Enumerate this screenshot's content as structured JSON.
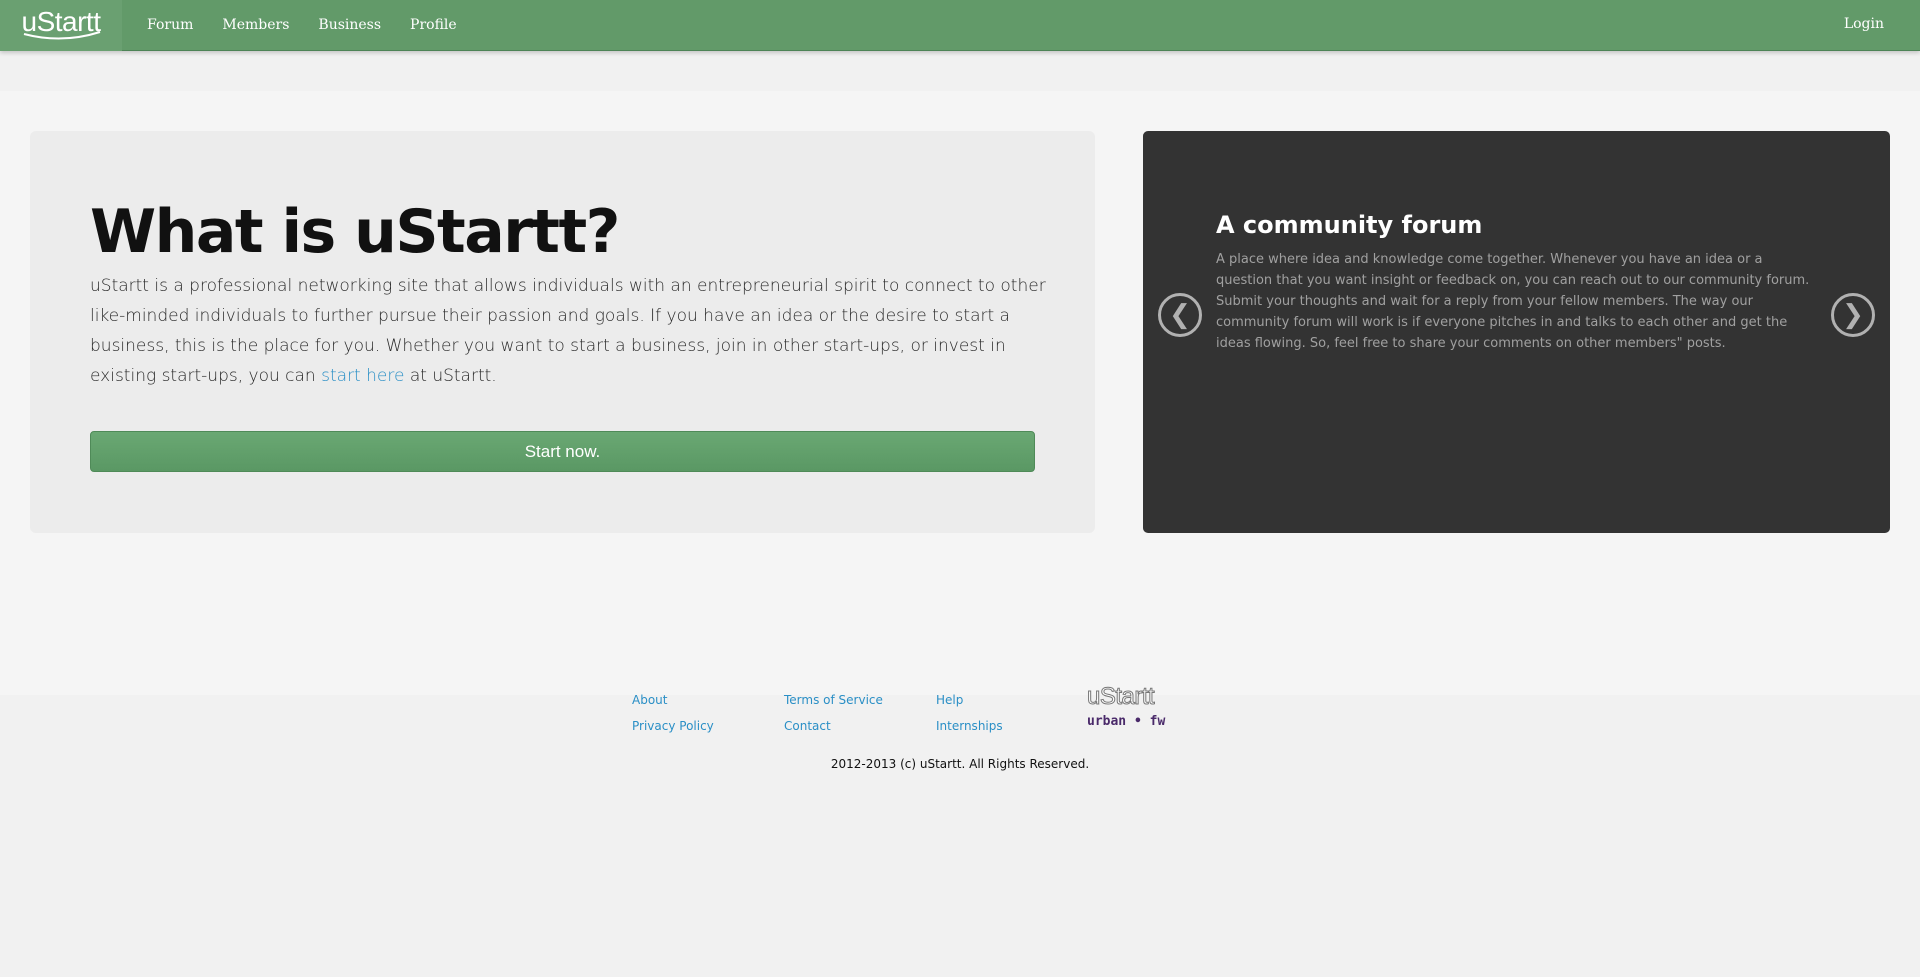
{
  "navbar": {
    "brand": "uStartt",
    "links": [
      {
        "label": "Forum"
      },
      {
        "label": "Members"
      },
      {
        "label": "Business"
      },
      {
        "label": "Profile"
      }
    ],
    "login": "Login",
    "colors": {
      "bar": "#629a69",
      "brand_bg": "#6aa071"
    }
  },
  "hero": {
    "title": "What is uStartt?",
    "body_before_link": "uStartt is a professional networking site that allows individuals with an entrepreneurial spirit to connect to other like-minded individuals to further pursue their passion and goals. If you have an idea or the desire to start a business, this is the place for you. Whether you want to start a business, join in other start-ups, or invest in existing start-ups, you can ",
    "link_text": "start here",
    "body_after_link": " at uStartt.",
    "button": "Start now."
  },
  "carousel": {
    "heading": "A community forum",
    "text": "A place where idea and knowledge come together. Whenever you have an idea or a question that you want insight or feedback on, you can reach out to our community forum. Submit your thoughts and wait for a reply from your fellow members. The way our community forum will work is if everyone pitches in and talks to each other and get the ideas flowing. So, feel free to share your comments on other members\" posts.",
    "prev_icon": "chevron-left-icon",
    "next_icon": "chevron-right-icon",
    "prev_glyph": "❮",
    "next_glyph": "❯"
  },
  "footer": {
    "col1": [
      "About",
      "Privacy Policy"
    ],
    "col2": [
      "Terms of Service",
      "Contact"
    ],
    "col3": [
      "Help",
      "Internships"
    ],
    "logo_top": "uStartt",
    "logo_bottom": "urban • fw",
    "copyright": "2012-2013 (c) uStartt. All Rights Reserved."
  }
}
